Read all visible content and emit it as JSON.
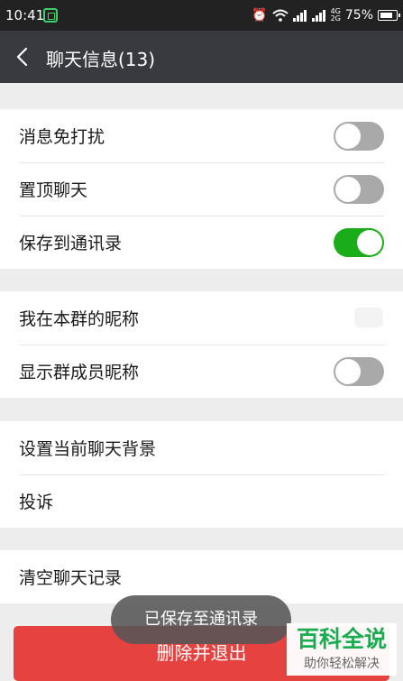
{
  "status_bar": {
    "time": "10:41",
    "network_top": "4G",
    "network_bottom": "2G",
    "battery": "75%"
  },
  "header": {
    "title": "聊天信息(13)"
  },
  "settings": {
    "mute": {
      "label": "消息免打扰",
      "on": false
    },
    "pin": {
      "label": "置顶聊天",
      "on": false
    },
    "save_contacts": {
      "label": "保存到通讯录",
      "on": true
    },
    "my_nickname": {
      "label": "我在本群的昵称"
    },
    "show_nicknames": {
      "label": "显示群成员昵称",
      "on": false
    },
    "background": {
      "label": "设置当前聊天背景"
    },
    "complain": {
      "label": "投诉"
    },
    "clear_history": {
      "label": "清空聊天记录"
    }
  },
  "delete_button": {
    "label": "删除并退出"
  },
  "toast": {
    "text": "已保存至通讯录"
  },
  "watermark": {
    "main": "百科全说",
    "sub": "助你轻松解决"
  },
  "colors": {
    "switch_on": "#1aad19",
    "switch_off": "#a9a9a9",
    "danger": "#e64340",
    "title_bar": "#393a3f"
  }
}
